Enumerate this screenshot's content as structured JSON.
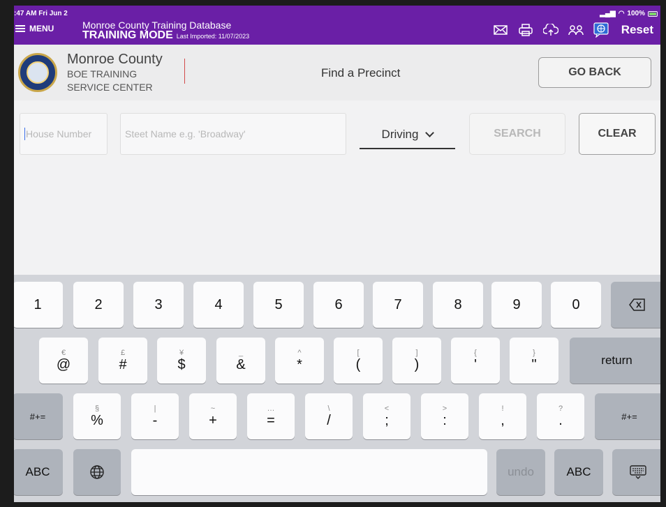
{
  "status": {
    "time": ":47 AM  Fri Jun 2",
    "battery": "100%"
  },
  "appbar": {
    "menu_label": "MENU",
    "title": "Monroe County Training Database",
    "mode": "TRAINING MODE",
    "last_imported": "Last Imported: 11/07/2023",
    "reset_label": "Reset",
    "accent_color": "#6a1fa6"
  },
  "subheader": {
    "county": "Monroe County",
    "org_line1": "BOE TRAINING",
    "org_line2": "SERVICE CENTER",
    "page_title": "Find a Precinct",
    "go_back_label": "GO BACK"
  },
  "search": {
    "house_placeholder": "House Number",
    "street_placeholder": "Steet Name e.g. 'Broadway'",
    "travel_mode": "Driving",
    "search_label": "SEARCH",
    "clear_label": "CLEAR"
  },
  "keyboard": {
    "row1": [
      "1",
      "2",
      "3",
      "4",
      "5",
      "6",
      "7",
      "8",
      "9",
      "0"
    ],
    "row2": [
      {
        "sub": "€",
        "main": "@"
      },
      {
        "sub": "£",
        "main": "#"
      },
      {
        "sub": "¥",
        "main": "$"
      },
      {
        "sub": "_",
        "main": "&"
      },
      {
        "sub": "^",
        "main": "*"
      },
      {
        "sub": "[",
        "main": "("
      },
      {
        "sub": "]",
        "main": ")"
      },
      {
        "sub": "{",
        "main": "'"
      },
      {
        "sub": "}",
        "main": "\""
      }
    ],
    "row3": [
      {
        "sub": "§",
        "main": "%"
      },
      {
        "sub": "|",
        "main": "-"
      },
      {
        "sub": "~",
        "main": "+"
      },
      {
        "sub": "…",
        "main": "="
      },
      {
        "sub": "\\",
        "main": "/"
      },
      {
        "sub": "<",
        "main": ";"
      },
      {
        "sub": ">",
        "main": ":"
      },
      {
        "sub": "!",
        "main": ","
      },
      {
        "sub": "?",
        "main": "."
      }
    ],
    "return_label": "return",
    "symbols_label": "#+=",
    "abc_label": "ABC",
    "undo_label": "undo"
  }
}
